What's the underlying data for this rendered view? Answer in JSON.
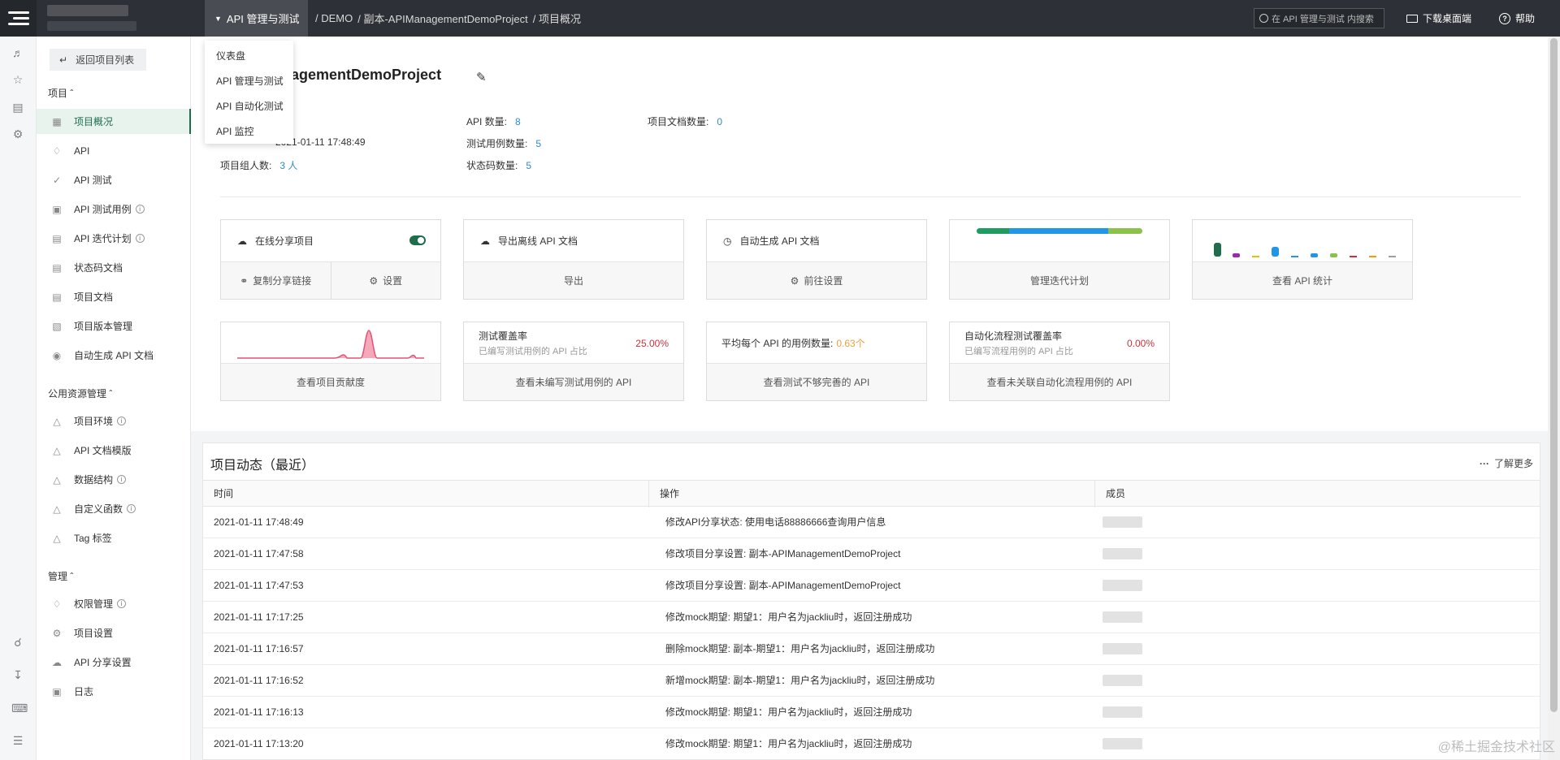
{
  "topbar": {
    "module": "API 管理与测试",
    "breadcrumbs": [
      "/ DEMO",
      "/ 副本-APIManagementDemoProject",
      "/ 项目概况"
    ],
    "search_placeholder": "在 API 管理与测试 内搜索",
    "download": "下载桌面端",
    "help": "帮助"
  },
  "dropdown": [
    "仪表盘",
    "API 管理与测试",
    "API 自动化测试",
    "API 监控"
  ],
  "sidebar": {
    "back": "返回项目列表",
    "sec_project": "项目",
    "project_items": [
      {
        "label": "项目概况"
      },
      {
        "label": "API"
      },
      {
        "label": "API 测试"
      },
      {
        "label": "API 测试用例"
      },
      {
        "label": "API 迭代计划"
      },
      {
        "label": "状态码文档"
      },
      {
        "label": "项目文档"
      },
      {
        "label": "项目版本管理"
      },
      {
        "label": "自动生成 API 文档"
      }
    ],
    "sec_public": "公用资源管理",
    "public_items": [
      {
        "label": "项目环境"
      },
      {
        "label": "API 文档模版"
      },
      {
        "label": "数据结构"
      },
      {
        "label": "自定义函数"
      },
      {
        "label": "Tag 标签"
      }
    ],
    "sec_manage": "管理",
    "manage_items": [
      {
        "label": "权限管理"
      },
      {
        "label": "项目设置"
      },
      {
        "label": "API 分享设置"
      },
      {
        "label": "日志"
      }
    ]
  },
  "project": {
    "title": "anagementDemoProject",
    "updated_value": "2021-01-11 17:48:49",
    "members_label": "项目组人数:",
    "members_value": "3 人",
    "api_count_label": "API 数量:",
    "api_count": "8",
    "case_count_label": "测试用例数量:",
    "case_count": "5",
    "status_count_label": "状态码数量:",
    "status_count": "5",
    "doc_count_label": "项目文档数量:",
    "doc_count": "0"
  },
  "cards": {
    "share": {
      "title": "在线分享项目",
      "copy": "复制分享链接",
      "settings": "设置",
      "enabled": true
    },
    "export": {
      "title": "导出离线 API 文档",
      "action": "导出"
    },
    "autogen": {
      "title": "自动生成 API 文档",
      "action": "前往设置"
    },
    "iteration": {
      "action": "管理迭代计划"
    },
    "api_stats": {
      "action": "查看 API 统计"
    },
    "contrib": {
      "action": "查看项目贡献度"
    },
    "coverage": {
      "label": "测试覆盖率",
      "sub": "已编写测试用例的 API 占比",
      "value": "25.00%",
      "action": "查看未编写测试用例的 API"
    },
    "avg": {
      "label": "平均每个 API 的用例数量:",
      "value": "0.63个",
      "action": "查看测试不够完善的 API"
    },
    "flow": {
      "label": "自动化流程测试覆盖率",
      "sub": "已编写流程用例的 API 占比",
      "value": "0.00%",
      "action": "查看未关联自动化流程用例的 API"
    }
  },
  "colors": {
    "brand": "#1f6d4c",
    "link": "#2f8bd0",
    "danger": "#c8333a",
    "warn": "#e6a23c"
  },
  "activity": {
    "title": "项目动态（最近）",
    "more": "了解更多",
    "columns": [
      "时间",
      "操作",
      "成员"
    ],
    "rows": [
      {
        "time": "2021-01-11 17:48:49",
        "op": "修改API分享状态: 使用电话88886666查询用户信息"
      },
      {
        "time": "2021-01-11 17:47:58",
        "op": "修改项目分享设置: 副本-APIManagementDemoProject"
      },
      {
        "time": "2021-01-11 17:47:53",
        "op": "修改项目分享设置: 副本-APIManagementDemoProject"
      },
      {
        "time": "2021-01-11 17:17:25",
        "op": "修改mock期望: 期望1：用户名为jackliu时，返回注册成功"
      },
      {
        "time": "2021-01-11 17:16:57",
        "op": "删除mock期望: 副本-期望1：用户名为jackliu时，返回注册成功"
      },
      {
        "time": "2021-01-11 17:16:52",
        "op": "新增mock期望: 副本-期望1：用户名为jackliu时，返回注册成功"
      },
      {
        "time": "2021-01-11 17:16:13",
        "op": "修改mock期望: 期望1：用户名为jackliu时，返回注册成功"
      },
      {
        "time": "2021-01-11 17:13:20",
        "op": "修改mock期望: 期望1：用户名为jackliu时，返回注册成功"
      }
    ]
  },
  "watermark": "@稀土掘金技术社区"
}
